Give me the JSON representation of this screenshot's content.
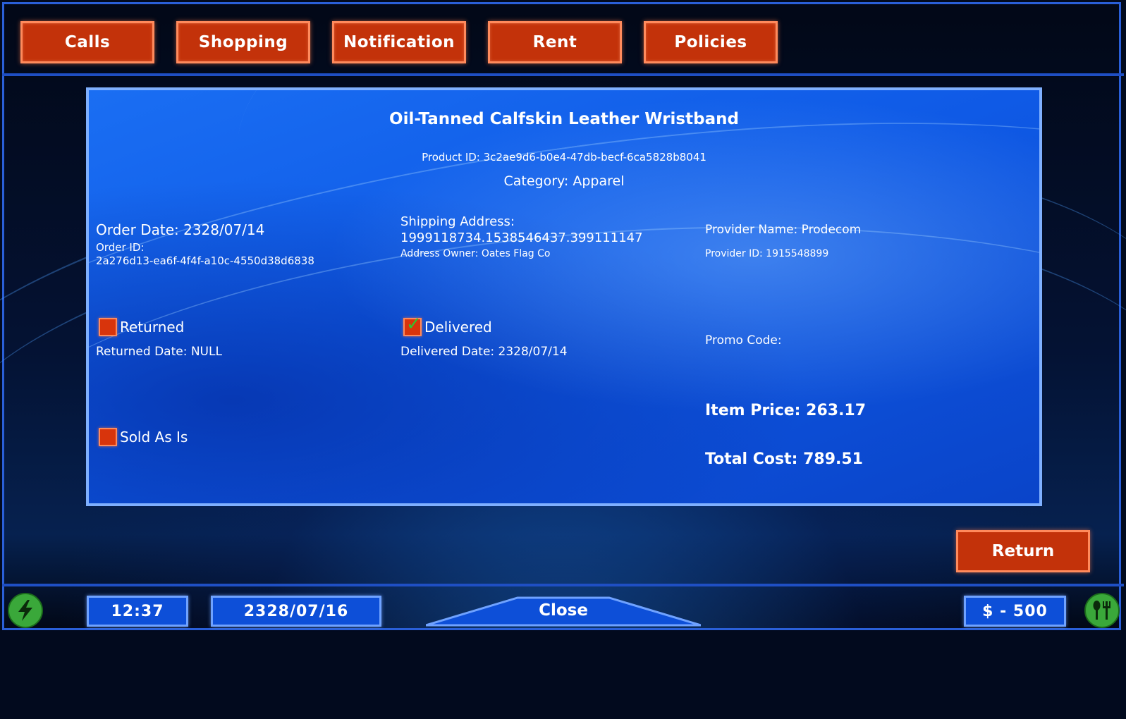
{
  "tabs": [
    {
      "label": "Calls"
    },
    {
      "label": "Shopping"
    },
    {
      "label": "Notification"
    },
    {
      "label": "Rent"
    },
    {
      "label": "Policies"
    }
  ],
  "product": {
    "title": "Oil-Tanned Calfskin Leather Wristband",
    "product_id": "Product ID: 3c2ae9d6-b0e4-47db-becf-6ca5828b8041",
    "category": "Category: Apparel"
  },
  "order": {
    "date": "Order Date: 2328/07/14",
    "id_label": "Order ID:",
    "id_value": "2a276d13-ea6f-4f4f-a10c-4550d38d6838"
  },
  "shipping": {
    "label": "Shipping Address:",
    "address": "1999118734.1538546437.399111147",
    "owner": "Address Owner: Oates Flag Co"
  },
  "provider": {
    "name": "Provider Name: Prodecom",
    "id": "Provider ID: 1915548899"
  },
  "status": {
    "returned_label": "Returned",
    "returned_checked": false,
    "returned_date": "Returned Date: NULL",
    "delivered_label": "Delivered",
    "delivered_checked": true,
    "delivered_date": "Delivered Date: 2328/07/14",
    "sold_as_is_label": "Sold As Is",
    "sold_as_is_checked": false,
    "promo_code": "Promo Code:"
  },
  "pricing": {
    "item_price": "Item Price: 263.17",
    "total_cost": "Total Cost: 789.51"
  },
  "return_button": "Return",
  "hud": {
    "time": "12:37",
    "date": "2328/07/16",
    "close_label": "Close",
    "money": "$ - 500",
    "energy_icon": "lightning-icon",
    "food_icon": "fork-knife-icon"
  },
  "colors": {
    "accent_button": "#c3320a",
    "panel_blue": "#1a6ef3",
    "hud_blue": "#0d4fd8"
  }
}
